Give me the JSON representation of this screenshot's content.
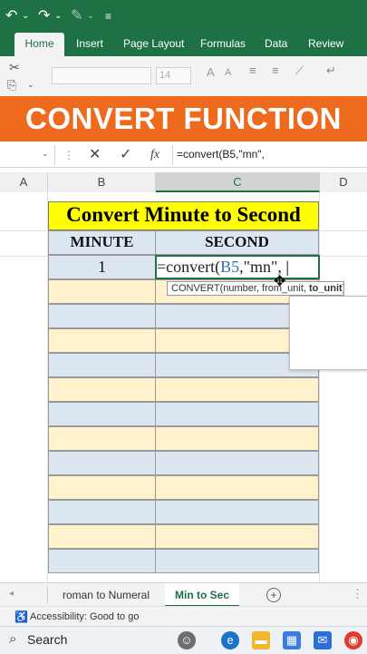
{
  "ribbon": {
    "tabs": [
      "Home",
      "Insert",
      "Page Layout",
      "Formulas",
      "Data",
      "Review"
    ],
    "active_tab": "Home",
    "font_size_value": "14"
  },
  "banner": {
    "text": "CONVERT FUNCTION"
  },
  "formula_bar": {
    "formula": "=convert(B5,\"mn\","
  },
  "columns": [
    "A",
    "B",
    "C",
    "D"
  ],
  "table": {
    "title": "Convert Minute to Second",
    "headers": [
      "MINUTE",
      "SECOND"
    ],
    "first_value": "1",
    "formula_prefix": "=convert(",
    "formula_ref": "B5",
    "formula_suffix": ",\"mn\", "
  },
  "tooltip": {
    "text_main": "CONVERT(number, from_unit, ",
    "text_bold": "to_unit",
    "text_end": ")"
  },
  "sheet_tabs": {
    "tabs": [
      "roman to Numeral",
      "Min to Sec"
    ],
    "active": "Min to Sec",
    "add_label": "+"
  },
  "status": {
    "accessibility": "Accessibility: Good to go"
  },
  "taskbar": {
    "search_label": "Search"
  },
  "colors": {
    "excel_green": "#1e7145",
    "banner_orange": "#ee6b1d",
    "title_yellow": "#ffff00",
    "row_blue": "#dce6f1",
    "row_yellow": "#fff2cc"
  }
}
